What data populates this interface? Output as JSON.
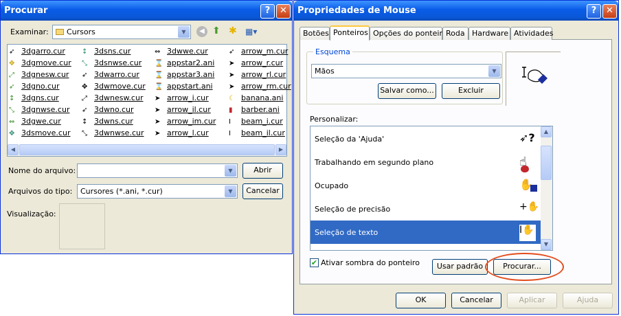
{
  "left_dialog": {
    "title": "Procurar",
    "help_glyph": "?",
    "close_glyph": "✕",
    "look_in_label": "Examinar:",
    "look_in_value": "Cursors",
    "files_col1": [
      "3dgarro.cur",
      "3dgmove.cur",
      "3dgnesw.cur",
      "3dgno.cur",
      "3dgns.cur",
      "3dgnwse.cur",
      "3dgwe.cur",
      "3dsmove.cur"
    ],
    "files_col2": [
      "3dsns.cur",
      "3dsnwse.cur",
      "3dwarro.cur",
      "3dwmove.cur",
      "3dwnesw.cur",
      "3dwno.cur",
      "3dwns.cur",
      "3dwnwse.cur"
    ],
    "files_col3": [
      "3dwwe.cur",
      "appstar2.ani",
      "appstar3.ani",
      "appstart.ani",
      "arrow_i.cur",
      "arrow_il.cur",
      "arrow_im.cur",
      "arrow_l.cur"
    ],
    "files_col4": [
      "arrow_m.cur",
      "arrow_r.cur",
      "arrow_rl.cur",
      "arrow_rm.cur",
      "banana.ani",
      "barber.ani",
      "beam_i.cur",
      "beam_il.cur"
    ],
    "filename_label": "Nome do arquivo:",
    "filename_value": "",
    "filetype_label": "Arquivos do tipo:",
    "filetype_value": "Cursores (*.ani, *.cur)",
    "open_button": "Abrir",
    "cancel_button": "Cancelar",
    "preview_label": "Visualização:"
  },
  "right_dialog": {
    "title": "Propriedades de Mouse",
    "help_glyph": "?",
    "close_glyph": "✕",
    "tabs": [
      "Botões",
      "Ponteiros",
      "Opções do ponteiro",
      "Roda",
      "Hardware",
      "Atividades"
    ],
    "scheme_group": "Esquema",
    "scheme_value": "Mãos",
    "save_as_button": "Salvar como...",
    "delete_button": "Excluir",
    "customize_label": "Personalizar:",
    "list_items": [
      "Seleção da 'Ajuda'",
      "Trabalhando em segundo plano",
      "Ocupado",
      "Seleção de precisão",
      "Seleção de texto"
    ],
    "shadow_checkbox": "Ativar sombra do ponteiro",
    "use_default_button": "Usar padrão",
    "browse_button": "Procurar...",
    "ok_button": "OK",
    "cancel_button": "Cancelar",
    "apply_button": "Aplicar",
    "help_button": "Ajuda"
  }
}
